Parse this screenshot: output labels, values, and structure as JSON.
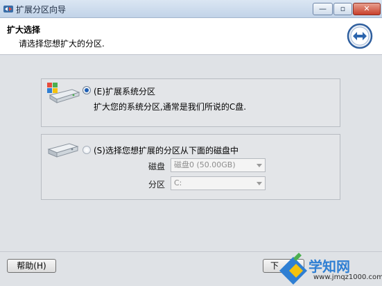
{
  "window": {
    "title": "扩展分区向导",
    "controls": {
      "minimize": "—",
      "maximize": "▫",
      "close": "✕"
    }
  },
  "header": {
    "title": "扩大选择",
    "subtitle": "请选择您想扩大的分区."
  },
  "options": {
    "system": {
      "label": "(E)扩展系统分区",
      "description": "扩大您的系统分区,通常是我们所说的C盘.",
      "selected": true
    },
    "choose": {
      "label": "(S)选择您想扩展的分区从下面的磁盘中",
      "selected": false,
      "disk_label": "磁盘",
      "disk_value": "磁盘0 (50.00GB)",
      "partition_label": "分区",
      "partition_value": "C:"
    }
  },
  "footer": {
    "help_label": "帮助(H)",
    "next_label": "下"
  },
  "watermark": {
    "brand": "学知网",
    "url": "www.jmqz1000.com"
  },
  "colors": {
    "accent": "#1e5fb4",
    "watermark_blue": "#2f7fd3"
  }
}
